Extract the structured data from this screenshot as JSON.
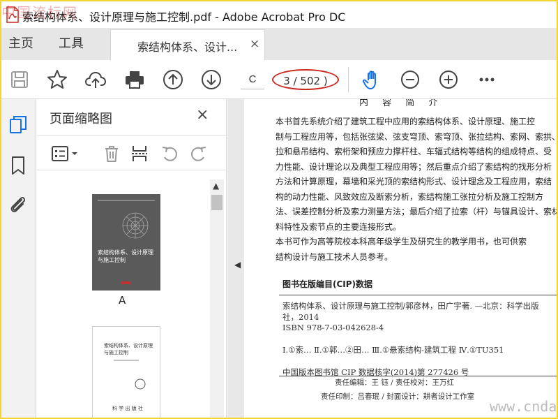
{
  "window": {
    "title": "索结构体系、设计原理与施工控制.pdf - Adobe Acrobat Pro DC",
    "watermark_top": "中国流标网",
    "watermark_bottom": "www.cndao.com"
  },
  "tabs": {
    "home": "主页",
    "tools": "工具",
    "document": "索结构体系、设计...",
    "close": "×"
  },
  "toolbar": {
    "page_input": "C",
    "page_count": "3 / 502 )",
    "icons": [
      "save-icon",
      "star-icon",
      "cloud-upload-icon",
      "print-icon",
      "arrow-up-circle-icon",
      "arrow-down-circle-icon",
      "hand-icon",
      "zoom-out-icon",
      "zoom-in-icon",
      "more-icon"
    ],
    "accent": "#1473e6",
    "annotation_color": "#c8281e"
  },
  "panel": {
    "title": "页面缩略图",
    "close": "×",
    "thumb1_cover_title": "索结构体系、设计原理\n与施工控制",
    "thumb1_label": "A",
    "thumb2_title": "索结构体系、设计原理\n与施工控制",
    "thumb2_publisher": "科 学 出 版 社"
  },
  "document": {
    "section_head": "内 容 简 介",
    "para1": [
      "    本书首先系统介绍了建筑工程中应用的索结构体系、设计原理、施工控",
      "制与工程应用等，包括张弦梁、弦支穹顶、索穹顶、张拉结构、索网、索拱、斜",
      "拉和悬吊结构、索桁架和预应力撑杆柱、车辐式结构等结构的组成特点、受",
      "力性能、设计理论以及典型工程应用等；然后重点介绍了索结构的找形分析",
      "方法和计算原理，幕墙和采光顶的索结构形式、设计理念及工程应用，索结",
      "构的动力性能、风致效应及断索分析，索结构施工张拉分析及施工控制方",
      "法、误差控制分析及索力测量方法；最后介绍了拉索（杆）与锚具设计、索材",
      "料特性及索节点的主要连接形式。"
    ],
    "para2": [
      "    本书可作为高等院校本科高年级学生及研究生的教学用书，也可供索",
      "结构设计与施工技术人员参考。"
    ],
    "cip_head": "图书在版编目(CIP)数据",
    "cip_lines": [
      "  索结构体系、设计原理与施工控制/郭彦林，田广宇著. —北京：科学出版",
      "社，2014",
      "  ISBN 978-7-03-042628-4",
      "",
      "  Ⅰ.①索…  Ⅱ.①郭…②田…  Ⅲ.①悬索结构-建筑工程  Ⅳ.①TU351",
      "",
      "  中国版本图书馆 CIP 数据核字(2014)第 277426 号"
    ],
    "credits": [
      "责任编辑：王  钰 / 责任校对：王万红",
      "责任印制：吕春珉 / 封面设计：耕者设计工作室"
    ]
  }
}
